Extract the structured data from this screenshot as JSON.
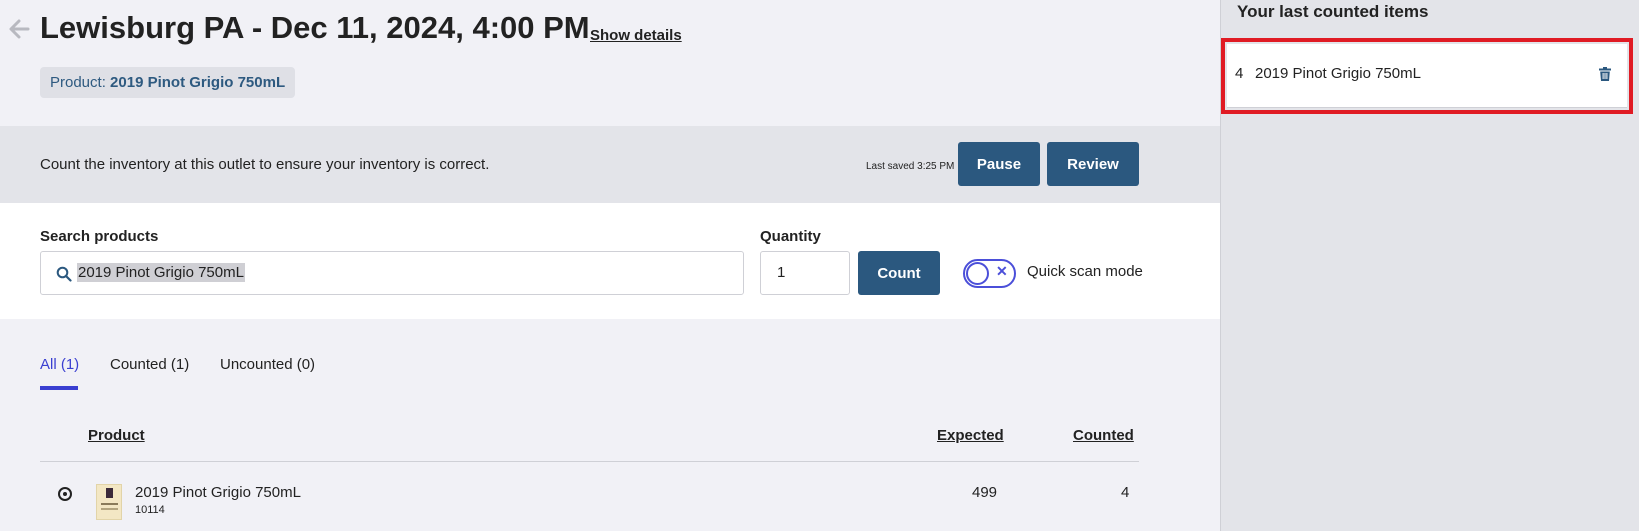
{
  "header": {
    "title": "Lewisburg PA - Dec 11, 2024, 4:00 PM",
    "show_details": "Show details",
    "product_chip_label": "Product:",
    "product_chip_value": "2019 Pinot Grigio 750mL"
  },
  "banner": {
    "text": "Count the inventory at this outlet to ensure your inventory is correct.",
    "last_saved": "Last saved 3:25 PM",
    "pause_label": "Pause",
    "review_label": "Review"
  },
  "search": {
    "label": "Search products",
    "value": "2019 Pinot Grigio 750mL",
    "quantity_label": "Quantity",
    "quantity_value": "1",
    "count_label": "Count",
    "quick_scan_label": "Quick scan mode",
    "quick_scan_on": false
  },
  "tabs": [
    {
      "label": "All (1)",
      "active": true
    },
    {
      "label": "Counted (1)",
      "active": false
    },
    {
      "label": "Uncounted (0)",
      "active": false
    }
  ],
  "table": {
    "columns": {
      "product": "Product",
      "expected": "Expected",
      "counted": "Counted"
    },
    "rows": [
      {
        "name": "2019 Pinot Grigio 750mL",
        "sku": "10114",
        "expected": "499",
        "counted": "4"
      }
    ]
  },
  "sidebar": {
    "title": "Your last counted items",
    "items": [
      {
        "qty": "4",
        "name": "2019 Pinot Grigio 750mL"
      }
    ]
  },
  "colors": {
    "primary_button": "#2b587f",
    "accent_tab": "#3a3fd1",
    "highlight_border": "#e01b24"
  },
  "icons": [
    "back-arrow-icon",
    "search-icon",
    "toggle-x-icon",
    "radio-icon",
    "product-thumbnail",
    "trash-icon"
  ]
}
